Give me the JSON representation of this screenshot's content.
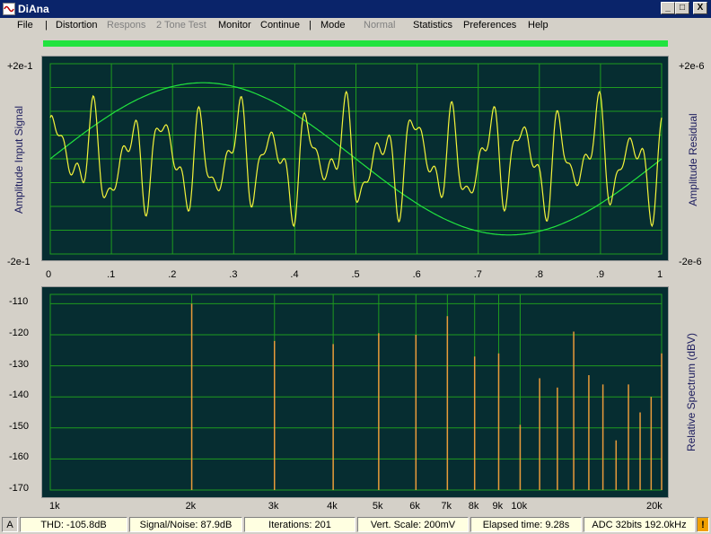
{
  "window": {
    "title": "DiAna",
    "minimize": "_",
    "maximize": "□",
    "close": "X"
  },
  "menu": {
    "file": "File",
    "sep": "|",
    "distortion": "Distortion",
    "respons": "Respons",
    "two_tone": "2 Tone Test",
    "monitor": "Monitor",
    "continue": "Continue",
    "mode": "Mode",
    "normal": "Normal",
    "statistics": "Statistics",
    "preferences": "Preferences",
    "help": "Help"
  },
  "colors": {
    "progress": "#21e33f",
    "plot_bg": "#062d31",
    "grid": "#1f9b1f",
    "sine": "#21e33f",
    "residual": "#f4f43a",
    "spectrum": "#e89a3a"
  },
  "top_plot": {
    "left_label": "Amplitude Input Signal",
    "right_label": "Amplitude Residual",
    "left_max": "+2e-1",
    "left_min": "-2e-1",
    "right_max": "+2e-6",
    "right_min": "-2e-6",
    "x_ticks": [
      "0",
      ".1",
      ".2",
      ".3",
      ".4",
      ".5",
      ".6",
      ".7",
      ".8",
      ".9",
      "1"
    ]
  },
  "bottom_plot": {
    "right_label": "Relative Spectrum (dBV)",
    "y_ticks": [
      "-110",
      "-120",
      "-130",
      "-140",
      "-150",
      "-160",
      "-170"
    ],
    "x_ticks": [
      "1k",
      "2k",
      "3k",
      "4k",
      "5k",
      "6k",
      "7k",
      "8k",
      "9k",
      "10k",
      "20k"
    ]
  },
  "chart_data": [
    {
      "type": "line",
      "x": [
        0,
        1
      ],
      "xlim": [
        0,
        1
      ],
      "ylim": [
        -0.2,
        0.2
      ],
      "series": [
        {
          "shape": "sine",
          "period": 1,
          "amplitude": 0.2
        },
        {
          "shape": "residual",
          "amplitude_range": [
            -2e-06,
            2e-06
          ]
        }
      ]
    },
    {
      "type": "bar",
      "x_scale": "log",
      "xlim": [
        1000,
        20000
      ],
      "ylim": [
        -170,
        -107
      ],
      "x": [
        2000,
        3000,
        4000,
        5000,
        6000,
        7000,
        8000,
        9000,
        10000,
        11000,
        12000,
        13000,
        14000,
        15000,
        16000,
        17000,
        18000,
        19000,
        20000
      ],
      "values": [
        -110,
        -122,
        -123,
        -119.5,
        -120,
        -114,
        -127,
        -126,
        -149,
        -134,
        -137,
        -119,
        -133,
        -136,
        -154,
        -136,
        -145,
        -140,
        -126
      ]
    }
  ],
  "status": {
    "mode": "A",
    "thd": "THD: -105.8dB",
    "snr": "Signal/Noise:  87.9dB",
    "iterations": "Iterations: 201",
    "vscale": "Vert. Scale: 200mV",
    "elapsed": "Elapsed time: 9.28s",
    "adc": "ADC 32bits 192.0kHz",
    "warn": "!"
  }
}
